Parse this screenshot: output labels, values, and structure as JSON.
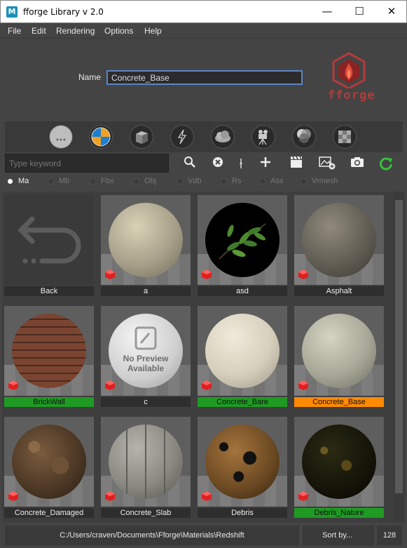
{
  "window": {
    "title": "fforge Library v 2.0",
    "app_icon": "M",
    "minimize_glyph": "—",
    "maximize_glyph": "☐",
    "close_glyph": "✕"
  },
  "menu": [
    "File",
    "Edit",
    "Rendering",
    "Options",
    "Help"
  ],
  "header": {
    "name_label": "Name",
    "name_value": "Concrete_Base",
    "logo_text": "fforge",
    "logo_color": "#b53a3a"
  },
  "categories": [
    {
      "icon": "more-dots-icon"
    },
    {
      "icon": "material-ball-icon"
    },
    {
      "icon": "cube-model-icon"
    },
    {
      "icon": "lightning-icon"
    },
    {
      "icon": "cloud-volume-icon"
    },
    {
      "icon": "camera-rig-icon"
    },
    {
      "icon": "color-overlap-icon"
    },
    {
      "icon": "checker-texture-icon"
    }
  ],
  "search": {
    "placeholder": "Type keyword"
  },
  "tools": {
    "search": "🔍",
    "clear": "⊗",
    "divider": "¦",
    "add": "+",
    "clapper": "🎬",
    "image_add": "🖼",
    "snapshot": "📷",
    "refresh": "↻"
  },
  "formats": [
    {
      "label": "Ma",
      "selected": true
    },
    {
      "label": "Mb",
      "selected": false
    },
    {
      "label": "Fbx",
      "selected": false
    },
    {
      "label": "Obj",
      "selected": false
    },
    {
      "label": "Vdb",
      "selected": false
    },
    {
      "label": "Rs",
      "selected": false
    },
    {
      "label": "Ass",
      "selected": false
    },
    {
      "label": "Vrmesh",
      "selected": false
    }
  ],
  "items": [
    {
      "label": "Back",
      "status": "none"
    },
    {
      "label": "a",
      "status": "none"
    },
    {
      "label": "asd",
      "status": "none"
    },
    {
      "label": "Asphalt",
      "status": "none"
    },
    {
      "label": "BrickWall",
      "status": "green"
    },
    {
      "label": "c",
      "status": "none"
    },
    {
      "label": "Concrete_Bare",
      "status": "green"
    },
    {
      "label": "Concrete_Base",
      "status": "orange"
    },
    {
      "label": "Concrete_Damaged",
      "status": "none"
    },
    {
      "label": "Concrete_Slab",
      "status": "none"
    },
    {
      "label": "Debris",
      "status": "none"
    },
    {
      "label": "Debris_Nature",
      "status": "green"
    }
  ],
  "no_preview": {
    "line1": "No Preview",
    "line2": "Available"
  },
  "status": {
    "path": "C:/Users/craven/Documents\\Fforge\\Materials\\Redshift",
    "sort": "Sort by...",
    "size": "128"
  }
}
